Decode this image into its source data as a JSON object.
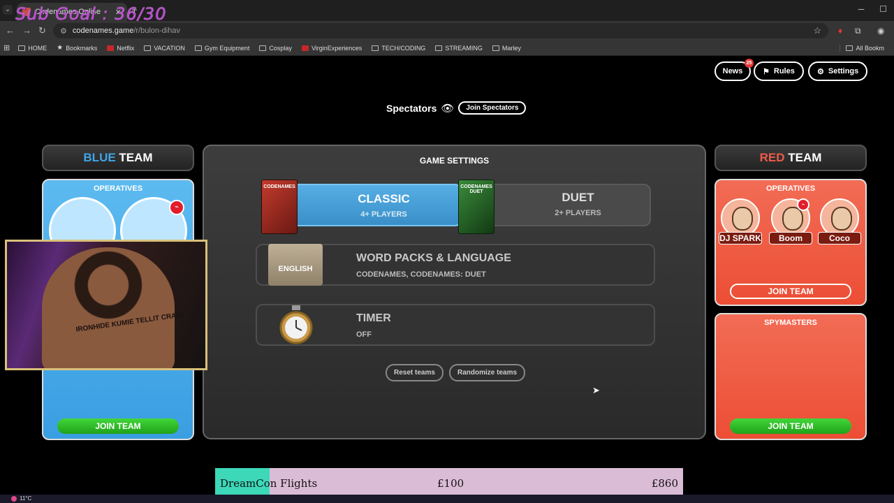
{
  "browser": {
    "tab_title": "Codenames Online",
    "url_host": "codenames.game",
    "url_path": "/r/bulon-dihav",
    "bookmarks": [
      "HOME",
      "Bookmarks",
      "Netflix",
      "VACATION",
      "Gym Equipment",
      "Cosplay",
      "VirginExperiences",
      "TECH/CODING",
      "STREAMING",
      "Marley"
    ],
    "all_bookmarks": "All Bookm"
  },
  "overlay": {
    "sub_goal": "Sub Goal : 36/30"
  },
  "header": {
    "news_label": "News",
    "news_count": "25",
    "rules_label": "Rules",
    "settings_label": "Settings"
  },
  "spectators": {
    "label": "Spectators",
    "join_label": "Join Spectators"
  },
  "blue_team": {
    "title_color_word": "BLUE",
    "title_rest": "TEAM",
    "operatives_label": "OPERATIVES",
    "join_label": "JOIN TEAM"
  },
  "red_team": {
    "title_color_word": "RED",
    "title_rest": "TEAM",
    "operatives_label": "OPERATIVES",
    "players": [
      "DJ SPARK",
      "Boom",
      "Coco"
    ],
    "join_operatives_label": "JOIN TEAM",
    "spymasters_label": "SPYMASTERS",
    "join_spymasters_label": "JOIN TEAM"
  },
  "game_settings": {
    "title": "GAME SETTINGS",
    "modes": [
      {
        "name": "CLASSIC",
        "players": "4+ PLAYERS",
        "box_word": "CODENAMES",
        "selected": true
      },
      {
        "name": "DUET",
        "players": "2+ PLAYERS",
        "box_word": "CODENAMES DUET",
        "selected": false
      }
    ],
    "word_packs": {
      "name": "WORD PACKS & LANGUAGE",
      "value": "CODENAMES, CODENAMES: DUET",
      "box_label": "ENGLISH"
    },
    "timer": {
      "name": "TIMER",
      "value": "OFF"
    },
    "reset_label": "Reset teams",
    "randomize_label": "Randomize teams"
  },
  "webcam": {
    "body_text": "IRONHIDE KUMIE TELLIT CRAIG"
  },
  "flight_goal": {
    "label": "DreamCon Flights",
    "raised": "£100",
    "target": "£860",
    "progress": 0.117
  },
  "taskbar": {
    "temperature": "11°C"
  },
  "colors": {
    "blue_accent": "#3fa7e8",
    "red_accent": "#ef5b48",
    "join_green": "#2bbd24",
    "flight_fill": "#3cd8b8",
    "flight_track": "#dbbcd6"
  }
}
